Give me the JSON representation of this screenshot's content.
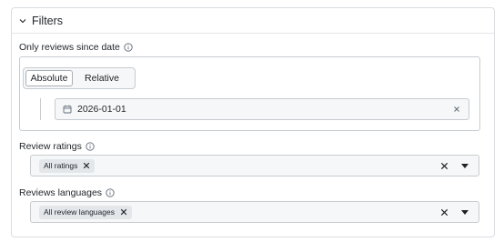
{
  "filters": {
    "title": "Filters",
    "since_date": {
      "label": "Only reviews since date",
      "modes": [
        "Absolute",
        "Relative"
      ],
      "active_mode": "Absolute",
      "value": "2026-01-01"
    },
    "ratings": {
      "label": "Review ratings",
      "chip": "All ratings"
    },
    "languages": {
      "label": "Reviews languages",
      "chip": "All review languages"
    }
  },
  "icons": {
    "header": "chevron-down-icon",
    "info": "info-icon",
    "calendar": "calendar-icon",
    "clear": "close-icon",
    "dropdown": "caret-down-icon"
  },
  "colors": {
    "border": "#c7ccd1",
    "field_bg": "#f6f7f8",
    "chip_bg": "#e4e7ea",
    "text": "#1f2328"
  }
}
